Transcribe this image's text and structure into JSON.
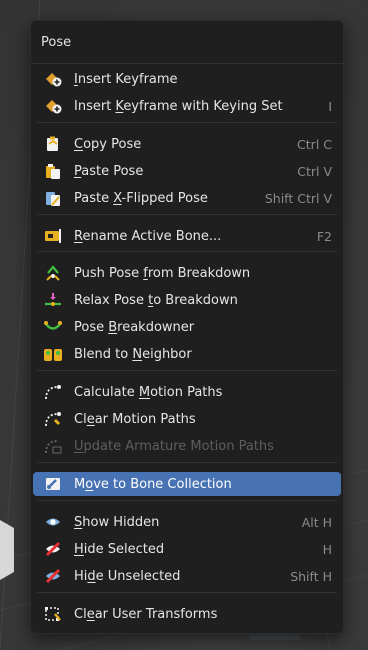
{
  "menu": {
    "title": "Pose",
    "items": [
      {
        "id": "insert-keyframe",
        "pre": "",
        "u": "I",
        "post": "nsert Keyframe",
        "shortcut": "",
        "icon": "keyframe-insert-icon"
      },
      {
        "id": "insert-keyframe-keying-set",
        "pre": "Insert ",
        "u": "K",
        "post": "eyframe with Keying Set",
        "shortcut": "I",
        "icon": "keyframe-insert-icon"
      },
      {
        "id": "copy-pose",
        "pre": "",
        "u": "C",
        "post": "opy Pose",
        "shortcut": "Ctrl C",
        "icon": "copy-pose-icon"
      },
      {
        "id": "paste-pose",
        "pre": "",
        "u": "P",
        "post": "aste Pose",
        "shortcut": "Ctrl V",
        "icon": "paste-pose-icon"
      },
      {
        "id": "paste-x-flipped-pose",
        "pre": "Paste ",
        "u": "X",
        "post": "-Flipped Pose",
        "shortcut": "Shift Ctrl V",
        "icon": "paste-flipped-icon"
      },
      {
        "id": "rename-active-bone",
        "pre": "",
        "u": "R",
        "post": "ename Active Bone...",
        "shortcut": "F2",
        "icon": "rename-icon"
      },
      {
        "id": "push-pose-from-breakdown",
        "pre": "Push Pose ",
        "u": "f",
        "post": "rom Breakdown",
        "shortcut": "",
        "icon": "push-pose-icon"
      },
      {
        "id": "relax-pose-to-breakdown",
        "pre": "Relax Pose ",
        "u": "t",
        "post": "o Breakdown",
        "shortcut": "",
        "icon": "relax-pose-icon"
      },
      {
        "id": "pose-breakdowner",
        "pre": "Pose ",
        "u": "B",
        "post": "reakdowner",
        "shortcut": "",
        "icon": "breakdowner-icon"
      },
      {
        "id": "blend-to-neighbor",
        "pre": "Blend to ",
        "u": "N",
        "post": "eighbor",
        "shortcut": "",
        "icon": "blend-neighbor-icon"
      },
      {
        "id": "calculate-motion-paths",
        "pre": "Calculate ",
        "u": "M",
        "post": "otion Paths",
        "shortcut": "",
        "icon": "motion-path-icon"
      },
      {
        "id": "clear-motion-paths",
        "pre": "Cl",
        "u": "e",
        "post": "ar Motion Paths",
        "shortcut": "",
        "icon": "motion-path-clear-icon"
      },
      {
        "id": "update-armature-motion-paths",
        "pre": "",
        "u": "U",
        "post": "pdate Armature Motion Paths",
        "shortcut": "",
        "icon": "motion-path-update-icon",
        "disabled": true
      },
      {
        "id": "move-to-bone-collection",
        "pre": "M",
        "u": "o",
        "post": "ve to Bone Collection",
        "shortcut": "",
        "icon": "bone-collection-icon",
        "active": true
      },
      {
        "id": "show-hidden",
        "pre": "",
        "u": "S",
        "post": "how Hidden",
        "shortcut": "Alt H",
        "icon": "eye-icon"
      },
      {
        "id": "hide-selected",
        "pre": "",
        "u": "H",
        "post": "ide Selected",
        "shortcut": "H",
        "icon": "hide-selected-icon"
      },
      {
        "id": "hide-unselected",
        "pre": "Hi",
        "u": "d",
        "post": "e Unselected",
        "shortcut": "Shift H",
        "icon": "hide-unselected-icon"
      },
      {
        "id": "clear-user-transforms",
        "pre": "Cl",
        "u": "e",
        "post": "ar User Transforms",
        "shortcut": "",
        "icon": "clear-transforms-icon"
      }
    ]
  },
  "colors": {
    "menu_bg": "#1f1f1f",
    "highlight": "#4772b3",
    "text": "#e6e6e6",
    "shortcut": "#8a8a8a",
    "disabled": "#5e5e5e"
  }
}
